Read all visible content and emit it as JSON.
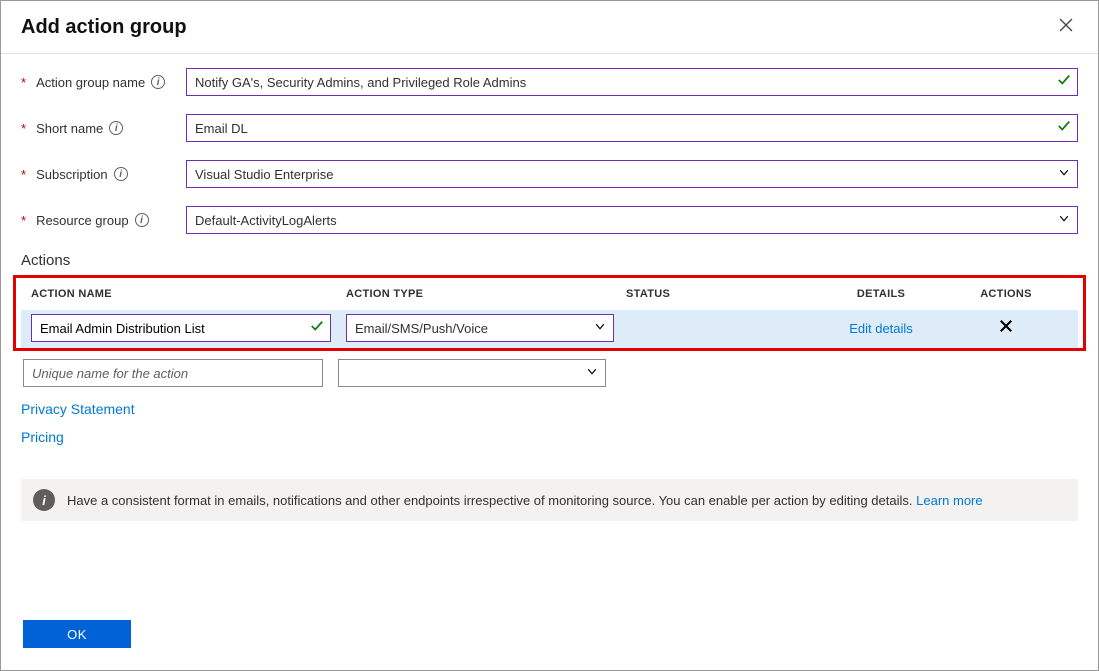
{
  "header": {
    "title": "Add action group"
  },
  "form": {
    "action_group_name": {
      "label": "Action group name",
      "value": "Notify GA's, Security Admins, and Privileged Role Admins"
    },
    "short_name": {
      "label": "Short name",
      "value": "Email DL"
    },
    "subscription": {
      "label": "Subscription",
      "value": "Visual Studio Enterprise"
    },
    "resource_group": {
      "label": "Resource group",
      "value": "Default-ActivityLogAlerts"
    }
  },
  "actions_section": {
    "heading": "Actions",
    "columns": {
      "name": "ACTION NAME",
      "type": "ACTION TYPE",
      "status": "STATUS",
      "details": "DETAILS",
      "actions": "ACTIONS"
    },
    "rows": [
      {
        "name": "Email Admin Distribution List",
        "type": "Email/SMS/Push/Voice",
        "details_link": "Edit details"
      }
    ],
    "new_row": {
      "name_placeholder": "Unique name for the action",
      "type_value": ""
    }
  },
  "links": {
    "privacy": "Privacy Statement",
    "pricing": "Pricing",
    "learn_more": "Learn more"
  },
  "banner": {
    "text": "Have a consistent format in emails, notifications and other endpoints irrespective of monitoring source. You can enable per action by editing details."
  },
  "buttons": {
    "ok": "OK"
  }
}
